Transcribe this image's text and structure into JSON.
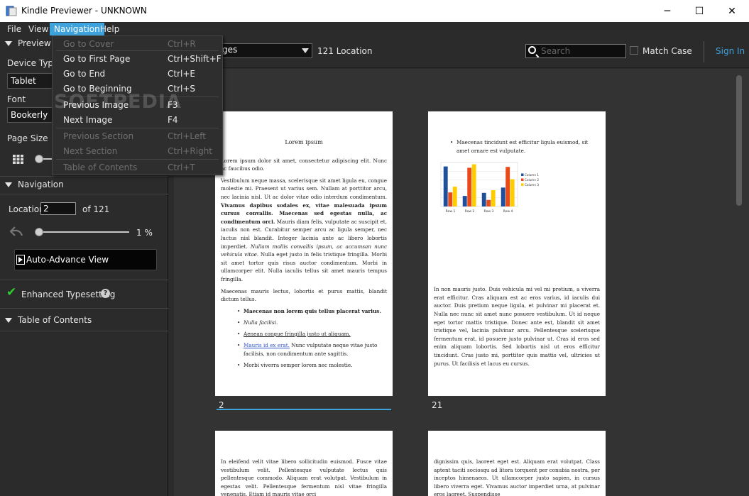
{
  "window": {
    "title": "Kindle Previewer - UNKNOWN"
  },
  "menubar": {
    "items": [
      "File",
      "View",
      "Navigation",
      "Help"
    ],
    "active": "Navigation"
  },
  "left_panel": {
    "preview_options_title": "Preview O",
    "device_type_label": "Device Type",
    "device_type_value": "Tablet",
    "font_label": "Font",
    "font_value": "Bookerly",
    "page_size_label": "Page Size",
    "navigation_title": "Navigation",
    "location_label": "Location",
    "location_value": "2",
    "location_of": "of 121",
    "progress_percent": "1 %",
    "progress_fraction": 0.01,
    "auto_advance_label": "Auto-Advance View",
    "enhanced_typesetting_label": "Enhanced Typesetting",
    "toc_title": "Table of Contents"
  },
  "toolbar": {
    "view_select_value": "ges",
    "location_count": "121 Location",
    "search_placeholder": "Search",
    "match_case_label": "Match Case",
    "sign_in_label": "Sign In"
  },
  "navigation_menu": [
    {
      "label": "Go to Cover",
      "shortcut": "Ctrl+R",
      "enabled": false
    },
    {
      "label": "Go to First Page",
      "shortcut": "Ctrl+Shift+F",
      "enabled": true
    },
    {
      "label": "Go to End",
      "shortcut": "Ctrl+E",
      "enabled": true
    },
    {
      "label": "Go to Beginning",
      "shortcut": "Ctrl+S",
      "enabled": true
    },
    {
      "label": "Previous Image",
      "shortcut": "F3",
      "enabled": true
    },
    {
      "label": "Next Image",
      "shortcut": "F4",
      "enabled": true
    },
    {
      "label": "Previous Section",
      "shortcut": "Ctrl+Left",
      "enabled": false
    },
    {
      "label": "Next Section",
      "shortcut": "Ctrl+Right",
      "enabled": false
    },
    {
      "label": "Table of Contents",
      "shortcut": "Ctrl+T",
      "enabled": false
    }
  ],
  "watermark": "SOFTPEDIA",
  "pages": {
    "page2": {
      "number": "2",
      "heading": "Lorem ipsum",
      "p1": "Lorem ipsum dolor sit amet, consectetur adipiscing elit. Nunc ac faucibus odio.",
      "p2a": "Vestibulum neque massa, scelerisque sit amet ligula eu, congue molestie mi. Praesent ut varius sem. Nullam at porttitor arcu, nec lacinia nisl. Ut ac dolor vitae odio interdum condimentum. ",
      "p2b": "Vivamus dapibus sodales ex, vitae malesuada ipsum cursus convallis. Maecenas sed egestas nulla, ac condimentum orci.",
      "p2c": " Mauris diam felis, vulputate ac suscipit et, iaculis non est. Curabitur semper arcu ac ligula semper, nec luctus nisl blandit. Integer lacinia ante ac libero lobortis imperdiet. ",
      "p2d": "Nullam mollis convallis ipsum, ac accumsan nunc vehicula vitae.",
      "p2e": " Nulla eget justo in felis tristique fringilla. Morbi sit amet tortor quis risus auctor condimentum. Morbi in ullamcorper elit. Nulla iaculis tellus sit amet mauris tempus fringilla.",
      "p3": "Maecenas mauris lectus, lobortis et purus mattis, blandit dictum tellus.",
      "li1": "Maecenas non lorem quis tellus placerat varius.",
      "li2": "Nulla facilisi.",
      "li3": "Aenean congue fringilla justo ut aliquam.",
      "li4a": "Mauris id ex erat.",
      "li4b": " Nunc vulputate neque vitae justo facilisis, non condimentum ante sagittis.",
      "li5": "Morbi viverra semper lorem nec molestie."
    },
    "page21": {
      "number": "21",
      "li1": "Maecenas tincidunt est efficitur ligula euismod, sit amet ornare est vulputate.",
      "p1": "In non mauris justo. Duis vehicula mi vel mi pretium, a viverra erat efficitur. Cras aliquam est ac eros varius, id iaculis dui auctor. Duis pretium neque ligula, et pulvinar mi placerat et. Nulla nec nunc sit amet nunc posuere vestibulum. Ut id neque eget tortor mattis tristique. Donec ante est, blandit sit amet tristique vel, lacinia pulvinar arcu. Pellentesque scelerisque fermentum erat, id posuere justo pulvinar ut. Cras id eros sed enim aliquam lobortis. Sed lobortis nisl ut eros efficitur tincidunt. Cras justo mi, porttitor quis mattis vel, ultricies ut purus. Ut facilisis et lacus eu cursus."
    },
    "page3": {
      "p1": "In eleifend velit vitae libero sollicitudin euismod. Fusce vitae vestibulum velit. Pellentesque vulputate lectus quis pellentesque commodo. Aliquam erat volutpat. Vestibulum in egestas velit. Pellentesque fermentum nisl vitae fringilla venenatis. Etiam id mauris vitae orci"
    },
    "page4": {
      "p1": "dignissim quis, laoreet eget est. Aliquam erat volutpat. Class aptent taciti sociosqu ad litora torquent per conubia nostra, per inceptos himenaeos. Ut ullamcorper justo sapien, in cursus libero viverra eget. Vivamus auctor imperdiet urna, at pulvinar eros laoreet. Suspendisse"
    }
  },
  "chart_data": {
    "type": "bar",
    "categories": [
      "Row 1",
      "Row 2",
      "Row 3",
      "Row 4"
    ],
    "series": [
      {
        "name": "Column 1",
        "values": [
          9.1,
          2.4,
          3.1,
          4.3
        ],
        "color": "#1f4e9a"
      },
      {
        "name": "Column 2",
        "values": [
          3.2,
          8.8,
          1.5,
          9.0
        ],
        "color": "#e84a1a"
      },
      {
        "name": "Column 3",
        "values": [
          4.5,
          9.6,
          3.7,
          6.2
        ],
        "color": "#ffcc00"
      }
    ],
    "ylim": [
      0,
      10
    ],
    "legend": "right",
    "grid": true
  }
}
